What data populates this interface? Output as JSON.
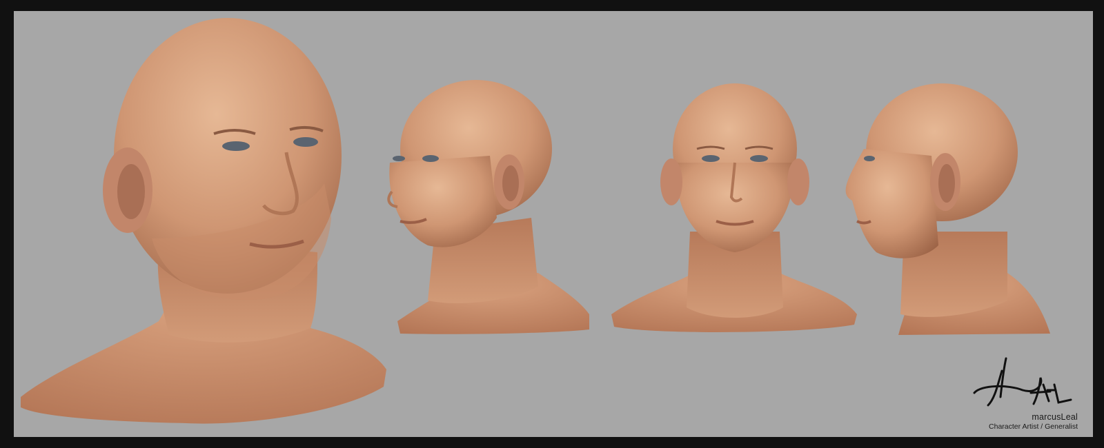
{
  "artwork": {
    "views": [
      {
        "name": "three-quarter-closeup"
      },
      {
        "name": "three-quarter-left"
      },
      {
        "name": "front"
      },
      {
        "name": "profile-left"
      }
    ],
    "background_color": "#a7a7a7",
    "border_color": "#111111"
  },
  "credit": {
    "signature_text": "MLeal",
    "artist_name": "marcusLeal",
    "artist_role": "Character Artist / Generalist"
  }
}
